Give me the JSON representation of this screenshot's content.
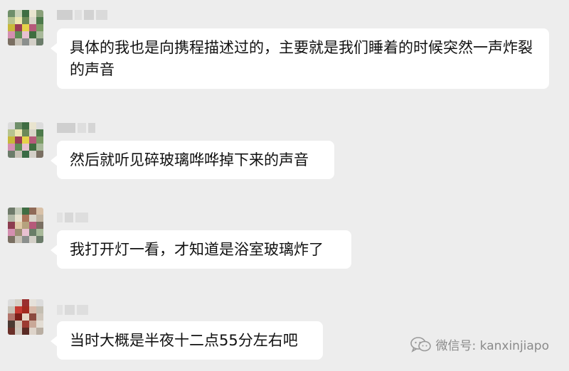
{
  "messages": [
    {
      "text": "具体的我也是向携程描述过的，主要就是我们睡着的时候突然一声炸裂的声音"
    },
    {
      "text": "然后就听见碎玻璃哗哗掉下来的声音"
    },
    {
      "text": "我打开灯一看，才知道是浴室玻璃炸了"
    },
    {
      "text": "当时大概是半夜十二点55分左右吧"
    }
  ],
  "watermark": {
    "label": "微信号: kanxinjiapo"
  },
  "colors": {
    "background": "#ededed",
    "bubble": "#ffffff",
    "text": "#111111"
  }
}
